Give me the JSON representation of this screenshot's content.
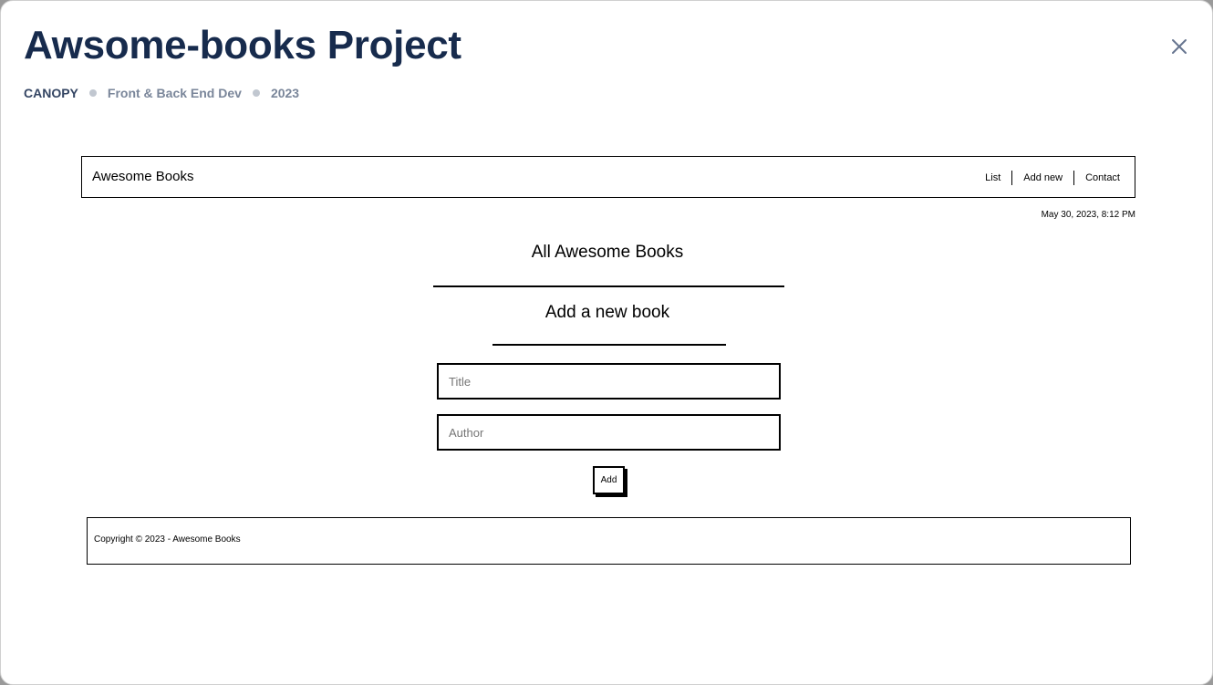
{
  "modal": {
    "title": "Awsome-books Project",
    "meta": {
      "client": "CANOPY",
      "role": "Front & Back End Dev",
      "year": "2023"
    },
    "close_icon": "close-icon"
  },
  "app": {
    "brand": "Awesome Books",
    "nav": [
      "List",
      "Add new",
      "Contact"
    ],
    "date": "May 30, 2023, 8:12 PM",
    "list_title": "All Awesome Books",
    "form_title": "Add a new book",
    "title_placeholder": "Title",
    "author_placeholder": "Author",
    "add_label": "Add",
    "footer": "Copyright © 2023 - Awesome Books"
  },
  "colors": {
    "title": "#172b4d",
    "meta_client": "#344563",
    "meta_item": "#7a869a",
    "meta_dot": "#c1c7d0"
  }
}
